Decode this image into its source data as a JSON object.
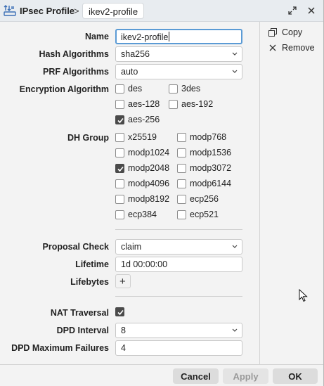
{
  "titlebar": {
    "app_title": "IPsec Profile",
    "separator": ">",
    "current_item": "ikev2-profile"
  },
  "form": {
    "name": {
      "label": "Name",
      "value": "ikev2-profile"
    },
    "hash_algorithms": {
      "label": "Hash Algorithms",
      "value": "sha256"
    },
    "prf_algorithms": {
      "label": "PRF Algorithms",
      "value": "auto"
    },
    "encryption": {
      "label": "Encryption Algorithm",
      "options": [
        {
          "label": "des",
          "checked": false
        },
        {
          "label": "3des",
          "checked": false
        },
        {
          "label": "aes-128",
          "checked": false
        },
        {
          "label": "aes-192",
          "checked": false
        },
        {
          "label": "aes-256",
          "checked": true
        }
      ]
    },
    "dh_group": {
      "label": "DH Group",
      "options": [
        {
          "label": "x25519",
          "checked": false
        },
        {
          "label": "modp768",
          "checked": false
        },
        {
          "label": "modp1024",
          "checked": false
        },
        {
          "label": "modp1536",
          "checked": false
        },
        {
          "label": "modp2048",
          "checked": true
        },
        {
          "label": "modp3072",
          "checked": false
        },
        {
          "label": "modp4096",
          "checked": false
        },
        {
          "label": "modp6144",
          "checked": false
        },
        {
          "label": "modp8192",
          "checked": false
        },
        {
          "label": "ecp256",
          "checked": false
        },
        {
          "label": "ecp384",
          "checked": false
        },
        {
          "label": "ecp521",
          "checked": false
        }
      ]
    },
    "proposal_check": {
      "label": "Proposal Check",
      "value": "claim"
    },
    "lifetime": {
      "label": "Lifetime",
      "value": "1d 00:00:00"
    },
    "lifebytes": {
      "label": "Lifebytes",
      "add_symbol": "+"
    },
    "nat_traversal": {
      "label": "NAT Traversal",
      "checked": true
    },
    "dpd_interval": {
      "label": "DPD Interval",
      "value": "8"
    },
    "dpd_max_failures": {
      "label": "DPD Maximum Failures",
      "value": "4"
    }
  },
  "side_actions": {
    "copy": "Copy",
    "remove": "Remove"
  },
  "footer": {
    "cancel": "Cancel",
    "apply": "Apply",
    "ok": "OK"
  },
  "icons": {
    "app": "ipsec-tunnel-icon",
    "restore": "restore-window-icon",
    "close": "close-icon",
    "copy": "copy-icon",
    "remove": "remove-x-icon",
    "dropdown": "chevron-down-icon",
    "checkbox": "checkmark-icon"
  },
  "colors": {
    "focus_border": "#5b9bd5",
    "checked_fill": "#4a4a4a",
    "titlebar_bg": "#e8ecf0"
  }
}
